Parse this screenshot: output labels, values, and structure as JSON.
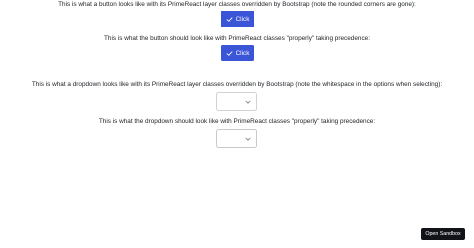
{
  "captions": {
    "button_bootstrap": "This is what a button looks like with its PrimeReact layer classes overridden by Bootstrap (note the rounded corners are gone):",
    "button_proper": "This is what the button should look like with PrimeReact classes \"properly\" taking precedence:",
    "dropdown_bootstrap": "This is what a dropdown looks like with its PrimeReact layer classes overridden by Bootstrap (note the whitespace in the options when selecting):",
    "dropdown_proper": "This is what the dropdown should look like with PrimeReact classes \"properly\" taking precedence:"
  },
  "buttons": {
    "bootstrap_label": "Click",
    "proper_label": "Click",
    "icon": "check-icon",
    "color": "#3b55d9"
  },
  "dropdowns": {
    "bootstrap_value": "",
    "proper_value": "",
    "icon": "chevron-down-icon"
  },
  "sandbox": {
    "label": "Open Sandbox"
  }
}
